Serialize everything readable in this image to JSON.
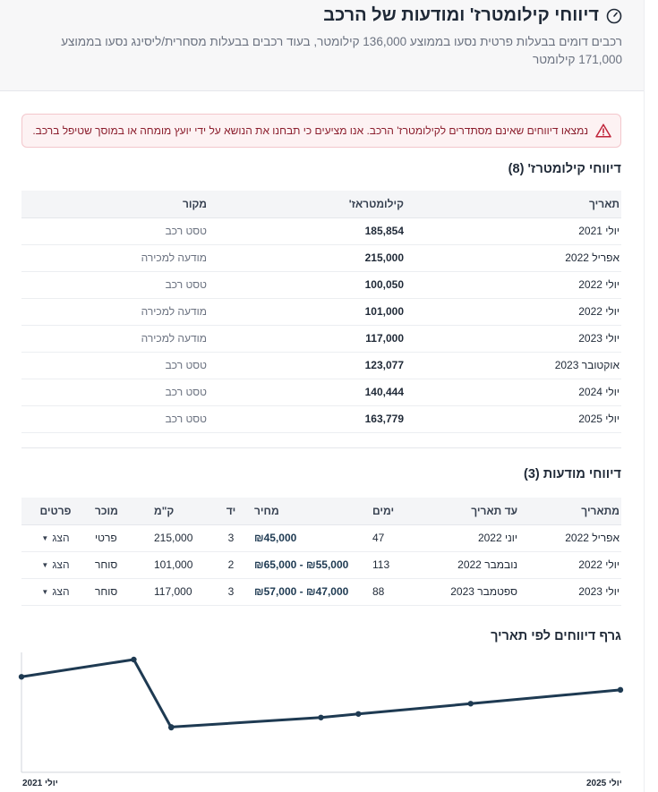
{
  "header": {
    "title": "דיווחי קילומטרז' ומודעות של הרכב",
    "subtitle": "רכבים דומים בבעלות פרטית נסעו בממוצע 136,000 קילומטר, בעוד רכבים בבעלות מסחרית/ליסינג נסעו בממוצע 171,000 קילומטר"
  },
  "alert": {
    "text": "נמצאו דיווחים שאינם מסתדרים לקילומטרז' הרכב. אנו מציעים כי תבחנו את הנושא על ידי יועץ מומחה או במוסך שטיפל ברכב."
  },
  "mileage": {
    "title": "דיווחי קילומטרז' (8)",
    "columns": [
      "תאריך",
      "קילומטראז'",
      "מקור"
    ],
    "rows": [
      [
        "יולי 2021",
        "185,854",
        "טסט רכב"
      ],
      [
        "אפריל 2022",
        "215,000",
        "מודעה למכירה"
      ],
      [
        "יולי 2022",
        "100,050",
        "טסט רכב"
      ],
      [
        "יולי 2022",
        "101,000",
        "מודעה למכירה"
      ],
      [
        "יולי 2023",
        "117,000",
        "מודעה למכירה"
      ],
      [
        "אוקטובר 2023",
        "123,077",
        "טסט רכב"
      ],
      [
        "יולי 2024",
        "140,444",
        "טסט רכב"
      ],
      [
        "יולי 2025",
        "163,779",
        "טסט רכב"
      ]
    ]
  },
  "ads": {
    "title": "דיווחי מודעות (3)",
    "columns": [
      "מתאריך",
      "עד תאריך",
      "ימים",
      "מחיר",
      "יד",
      "ק\"מ",
      "מוכר",
      "פרטים"
    ],
    "show_label": "הצג",
    "rows": [
      [
        "אפריל 2022",
        "יוני 2022",
        "47",
        "₪45,000",
        "3",
        "215,000",
        "פרטי"
      ],
      [
        "יולי 2022",
        "נובמבר 2022",
        "113",
        "₪55,000 - ₪65,000",
        "2",
        "101,000",
        "סוחר"
      ],
      [
        "יולי 2023",
        "ספטמבר 2023",
        "88",
        "₪47,000 - ₪57,000",
        "3",
        "117,000",
        "סוחר"
      ]
    ]
  },
  "chart": {
    "title": "גרף דיווחים לפי תאריך",
    "x_start_label": "יולי 2021",
    "x_end_label": "יולי 2025"
  },
  "chart_data": {
    "type": "line",
    "x": [
      "2021-07",
      "2022-04",
      "2022-07",
      "2022-07",
      "2023-07",
      "2023-10",
      "2024-07",
      "2025-07"
    ],
    "y": [
      185854,
      215000,
      100050,
      101000,
      117000,
      123077,
      140444,
      163779
    ],
    "xlim": [
      "2021-07",
      "2025-07"
    ],
    "title": "גרף דיווחים לפי תאריך",
    "colors": {
      "line": "#1e3a52",
      "axis": "#d1d5db"
    }
  }
}
